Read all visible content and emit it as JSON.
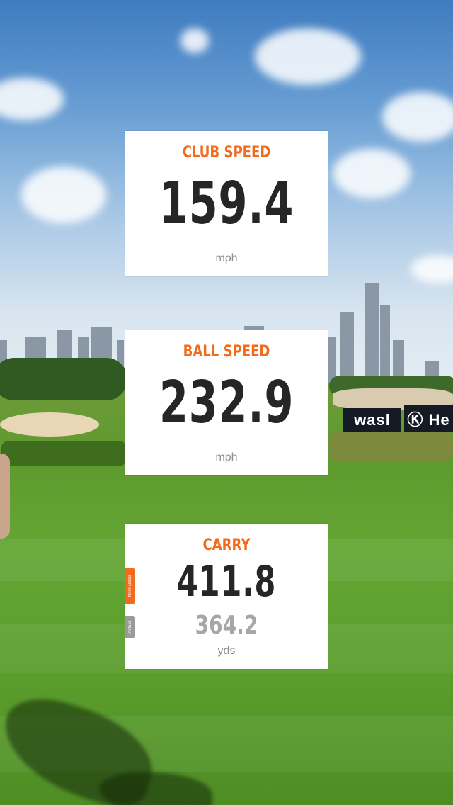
{
  "metrics": {
    "club_speed": {
      "label": "CLUB SPEED",
      "value": "159.4",
      "unit": "mph"
    },
    "ball_speed": {
      "label": "BALL SPEED",
      "value": "232.9",
      "unit": "mph"
    },
    "carry": {
      "label": "CARRY",
      "normalized_value": "411.8",
      "actual_value": "364.2",
      "unit": "yds",
      "normalized_tag": "Normalized",
      "actual_tag": "Actual"
    }
  },
  "background": {
    "signage": [
      "wasl",
      "Ⓚ He"
    ]
  },
  "colors": {
    "accent": "#f26a1b",
    "value_text": "#262626",
    "secondary_text": "#a6a6a6",
    "card_bg": "#ffffff"
  }
}
